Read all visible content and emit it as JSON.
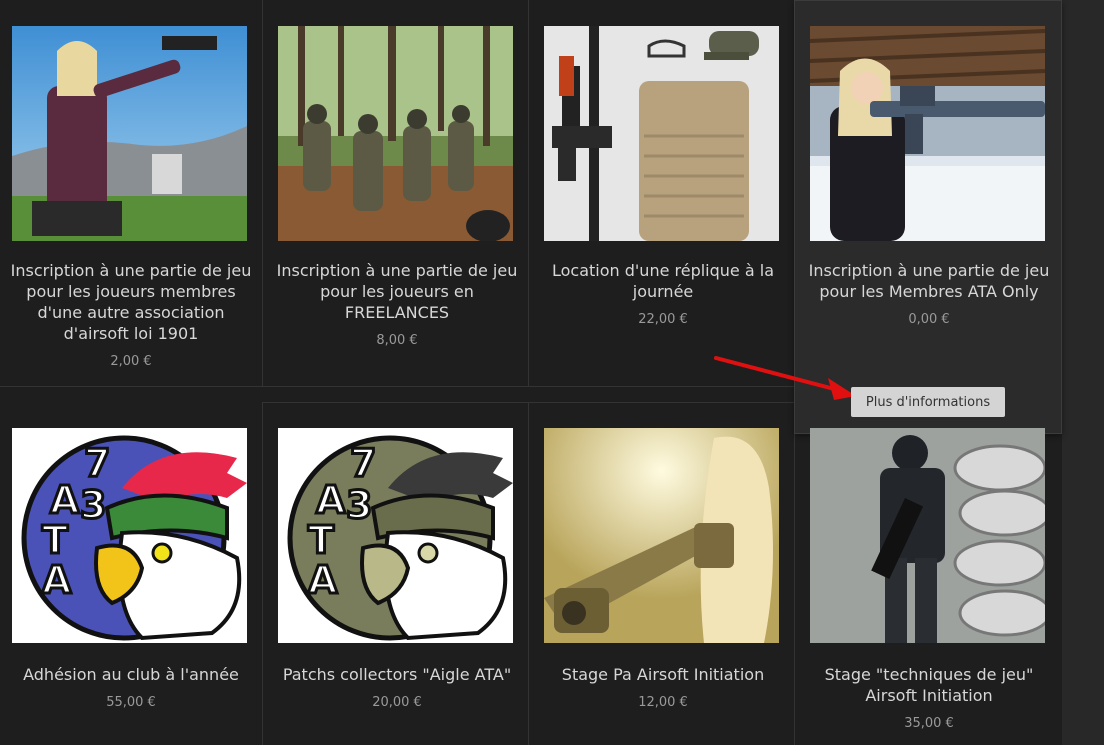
{
  "products": [
    {
      "title": "Inscription à une partie de jeu pour les joueurs membres d'une autre association d'airsoft loi 1901",
      "price": "2,00 €"
    },
    {
      "title": "Inscription à une partie de jeu pour les joueurs en FREELANCES",
      "price": "8,00 €"
    },
    {
      "title": "Location d'une réplique à la journée",
      "price": "22,00 €"
    },
    {
      "title": "Inscription à une partie de jeu pour les Membres ATA Only",
      "price": "0,00 €"
    },
    {
      "title": "Adhésion au club à l'année",
      "price": "55,00 €"
    },
    {
      "title": "Patchs collectors \"Aigle ATA\"",
      "price": "20,00 €"
    },
    {
      "title": "Stage Pa Airsoft Initiation",
      "price": "12,00 €"
    },
    {
      "title": "Stage \"techniques de jeu\" Airsoft Initiation",
      "price": "35,00 €"
    }
  ],
  "more_info_label": "Plus d'informations",
  "logo_text": {
    "a": "A",
    "t": "T",
    "seven": "7",
    "three": "3"
  },
  "colors": {
    "background": "#1e1e1e",
    "accent_arrow": "#e01010",
    "button": "#d4d4d4"
  }
}
